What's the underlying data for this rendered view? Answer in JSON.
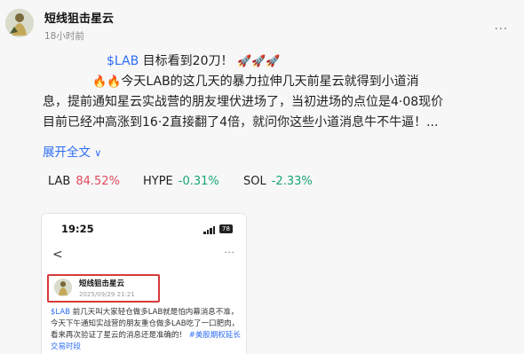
{
  "post": {
    "author": "短线狙击星云",
    "time": "18小时前",
    "more": "···",
    "line1_ticker": "$LAB",
    "line1_text": " 目标看到20刀！",
    "line1_emoji": "🚀🚀🚀",
    "line2_emoji": "🔥🔥",
    "line2_text": "今天LAB的这几天的暴力拉伸几天前星云就得到小道消",
    "line3_text": "息，提前通知星云实战营的朋友埋伏进场了，当初进场的点位是4·08现价",
    "line4_text": "目前已经冲高涨到16·2直接翻了4倍，就问你这些小道消息牛不牛逼！...",
    "expand_label": "展开全文",
    "expand_arrow": "∨"
  },
  "quotes": [
    {
      "symbol": "LAB",
      "change": "84.52%",
      "direction": "up"
    },
    {
      "symbol": "HYPE",
      "change": "-0.31%",
      "direction": "down"
    },
    {
      "symbol": "SOL",
      "change": "-2.33%",
      "direction": "down"
    }
  ],
  "screenshot": {
    "status_time": "19:25",
    "battery": "78",
    "back": "<",
    "menu": "···",
    "author": "短线狙击星云",
    "date": "2025/09/29 21:21",
    "text_ticker": "$LAB",
    "text_body": " 前几天叫大家轻仓做多LAB就是怕内幕消息不准，今天下午通知实战营的朋友重仓做多LAB吃了一口肥肉，看来再次验证了星云的消息还是准确的！",
    "text_tag": "#美股期权延长交易时段"
  },
  "colors": {
    "link": "#2d6df6",
    "up": "#e24b5a",
    "down": "#17a673",
    "highlight_box": "#d73a3a"
  }
}
